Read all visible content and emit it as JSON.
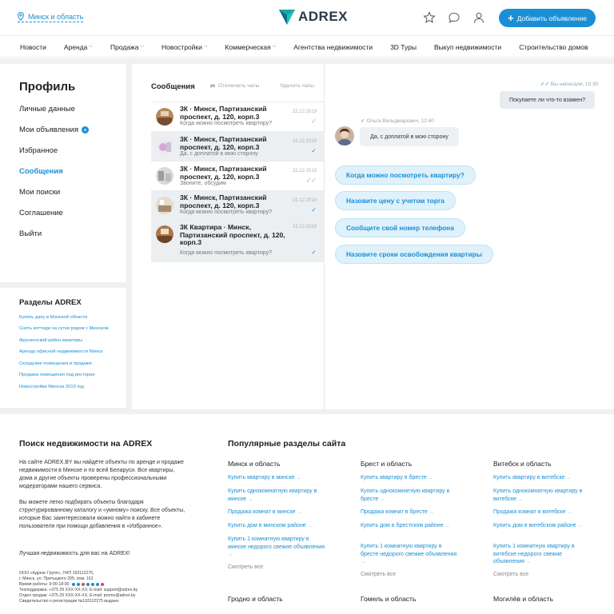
{
  "header": {
    "location": "Минск и область",
    "logo": "ADREX",
    "add_button": "Добавить объявление"
  },
  "nav": [
    "Новости",
    "Аренда",
    "Продажа",
    "Новостройки",
    "Коммерческая",
    "Агентства недвижимости",
    "3D Туры",
    "Выкуп недвижимости",
    "Строительство домов"
  ],
  "profile": {
    "title": "Профиль",
    "menu": [
      "Личные данные",
      "Мои объявления",
      "Избранное",
      "Сообщения",
      "Мои поиски",
      "Соглашение",
      "Выйти"
    ],
    "active": "Сообщения"
  },
  "sections": {
    "title": "Разделы ADREX",
    "links": [
      "Купить дачу в Минской области",
      "Снять коттедж на сутки рядом с Минском",
      "Фрунзенский район квартиры",
      "Аренда офисной недвижимости Минск",
      "Складские помещения в продаже",
      "Продажа помещения под ресторан",
      "Новостройки Минска 2019 год"
    ]
  },
  "messages": {
    "title": "Сообщения",
    "disable": "Отключить чаты",
    "delete": "Удалить чаты",
    "rows": [
      {
        "title": "3К · Минск, Партизанский проспект, д. 120, корп.3",
        "sub": "Когда можно посмотреть квартиру?",
        "date": "22.12.2019"
      },
      {
        "title": "3К · Минск, Партизанский проспект, д. 120, корп.3",
        "sub": "Да, с доплатой в мою сторону",
        "date": "22.12.2019"
      },
      {
        "title": "3К · Минск, Партизанский проспект, д. 120, корп.3",
        "sub": "Звоните, обсудим",
        "date": "22.12.2019"
      },
      {
        "title": "3К · Минск, Партизанский проспект, д. 120, корп.3",
        "sub": "Когда можно посмотреть квартиру?",
        "date": "22.12.2019"
      },
      {
        "title": "3К Квартира · Минск, Партизанский проспект, д. 120, корп.3",
        "sub": "Когда можно посмотреть квартиру?",
        "date": "22.12.2019"
      }
    ]
  },
  "chat": {
    "out_meta": "Вы написали, 10:30",
    "out_text": "Покупаете ли что-то взамен?",
    "in_meta": "Ольга Вальдмарович, 12:40",
    "in_text": "Да, с доплатой в мою сторону",
    "quick": [
      "Когда можно посмотреть квартиру?",
      "Назовите цену с учетом торга",
      "Сообщите свой номер телефона",
      "Назовите сроки освобождения квартиры"
    ]
  },
  "footer": {
    "left_title": "Поиск недвижимости на ADREX",
    "p1": "На сайте ADREX.BY вы найдёте объекты по аренде и продаже недвижимости в Минске и по всей Беларуси. Все квартиры, дома и другие объекты проверены профессиональными модераторами нашего сервиса.",
    "p2": "Вы можете легко подбирать объекты благодаря структурированному каталогу и «умному» поиску. Все объекты, которые Вас заинтересовали можно найти в кабинете пользователя при помощи добавления в «Избранное».",
    "p3": "Лучшая недвижимость для вас на ADREX!",
    "legal": [
      "ООО «Адрекс Групп», УНП 193112275,",
      "г. Минск, ул. Притыцкого 205, пом. 161",
      "Время работы: 9:00-18:00",
      "Техподдержка: +375 29 XXX-XX-XX,   E-mail: support@adrex.by",
      "Отдел продаж: +375 29 XXX-XX-XX,   E-mail: promo@adrex.by",
      "Свидетельство о регистрации №193112275 выдано"
    ],
    "right_title": "Популярные разделы сайта",
    "columns": [
      {
        "head": "Минск и область",
        "links": [
          "Купить квартиру в минске",
          "Купить однокомнатную квартиру в минске",
          "Продажа комнат в минске",
          "Купить дом в минском районе",
          "Купить 1 комнатную квартиру в минске недорого свежие объявления"
        ]
      },
      {
        "head": "Брест и область",
        "links": [
          "Купить квартиру в бресте",
          "Купить однокомнатную квартиру в бресте",
          "Продажа комнат в бресте",
          "Купить дом в брестском районе",
          "Купить 1 комнатную квартиру в бресте недорого свежие объявления"
        ]
      },
      {
        "head": "Витебск и область",
        "links": [
          "Купить квартиру в витебске",
          "Купить однокомнатную квартиру в витебске",
          "Продажа комнат в витебске",
          "Купить дом в витебском районе",
          "Купить 1 комнатную квартиру в витебске недорого свежие объявления"
        ]
      }
    ],
    "see_all": "Смотреть все",
    "bottom_heads": [
      "Гродно и область",
      "Гомель и область",
      "Могилёв и область"
    ]
  },
  "colors": {
    "accent": "#1a8fd6",
    "logo_teal": "#1aa3a3",
    "bg_gray": "#eef1f3"
  }
}
